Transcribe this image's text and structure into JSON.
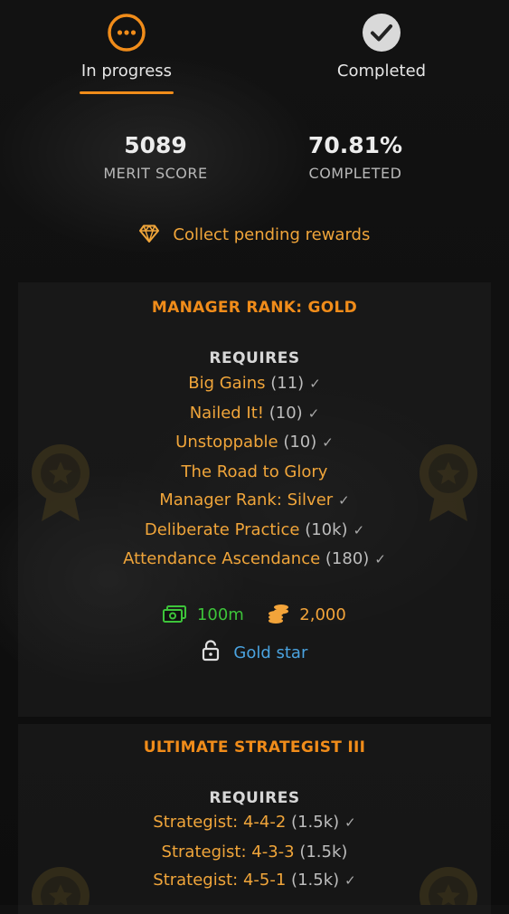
{
  "tabs": {
    "in_progress": {
      "label": "In progress",
      "icon": "ellipsis-circle-icon"
    },
    "completed": {
      "label": "Completed",
      "icon": "check-circle-icon"
    }
  },
  "stats": {
    "merit_score": {
      "value": "5089",
      "label": "MERIT SCORE"
    },
    "completed": {
      "value": "70.81%",
      "label": "COMPLETED"
    }
  },
  "collect": {
    "label": "Collect pending rewards",
    "icon": "diamond-icon"
  },
  "cards": [
    {
      "title": "MANAGER RANK: GOLD",
      "requires_label": "REQUIRES",
      "requirements": [
        {
          "name": "Big Gains",
          "count": "(11)",
          "done": true
        },
        {
          "name": "Nailed It!",
          "count": "(10)",
          "done": true
        },
        {
          "name": "Unstoppable",
          "count": "(10)",
          "done": true
        },
        {
          "name": "The Road to Glory",
          "count": "",
          "done": false
        },
        {
          "name": "Manager Rank: Silver",
          "count": "",
          "done": true
        },
        {
          "name": "Deliberate Practice",
          "count": "(10k)",
          "done": true
        },
        {
          "name": "Attendance Ascendance",
          "count": "(180)",
          "done": true
        }
      ],
      "rewards": {
        "cash": "100m",
        "coins": "2,000"
      },
      "unlock": "Gold star"
    },
    {
      "title": "ULTIMATE STRATEGIST III",
      "requires_label": "REQUIRES",
      "requirements": [
        {
          "name": "Strategist: 4-4-2",
          "count": "(1.5k)",
          "done": true
        },
        {
          "name": "Strategist: 4-3-3",
          "count": "(1.5k)",
          "done": false
        },
        {
          "name": "Strategist: 4-5-1",
          "count": "(1.5k)",
          "done": true
        }
      ]
    }
  ],
  "colors": {
    "accent": "#f08c1a",
    "reward_text": "#f0a53a",
    "cash": "#3dc43a",
    "unlock": "#4aa3e0"
  }
}
